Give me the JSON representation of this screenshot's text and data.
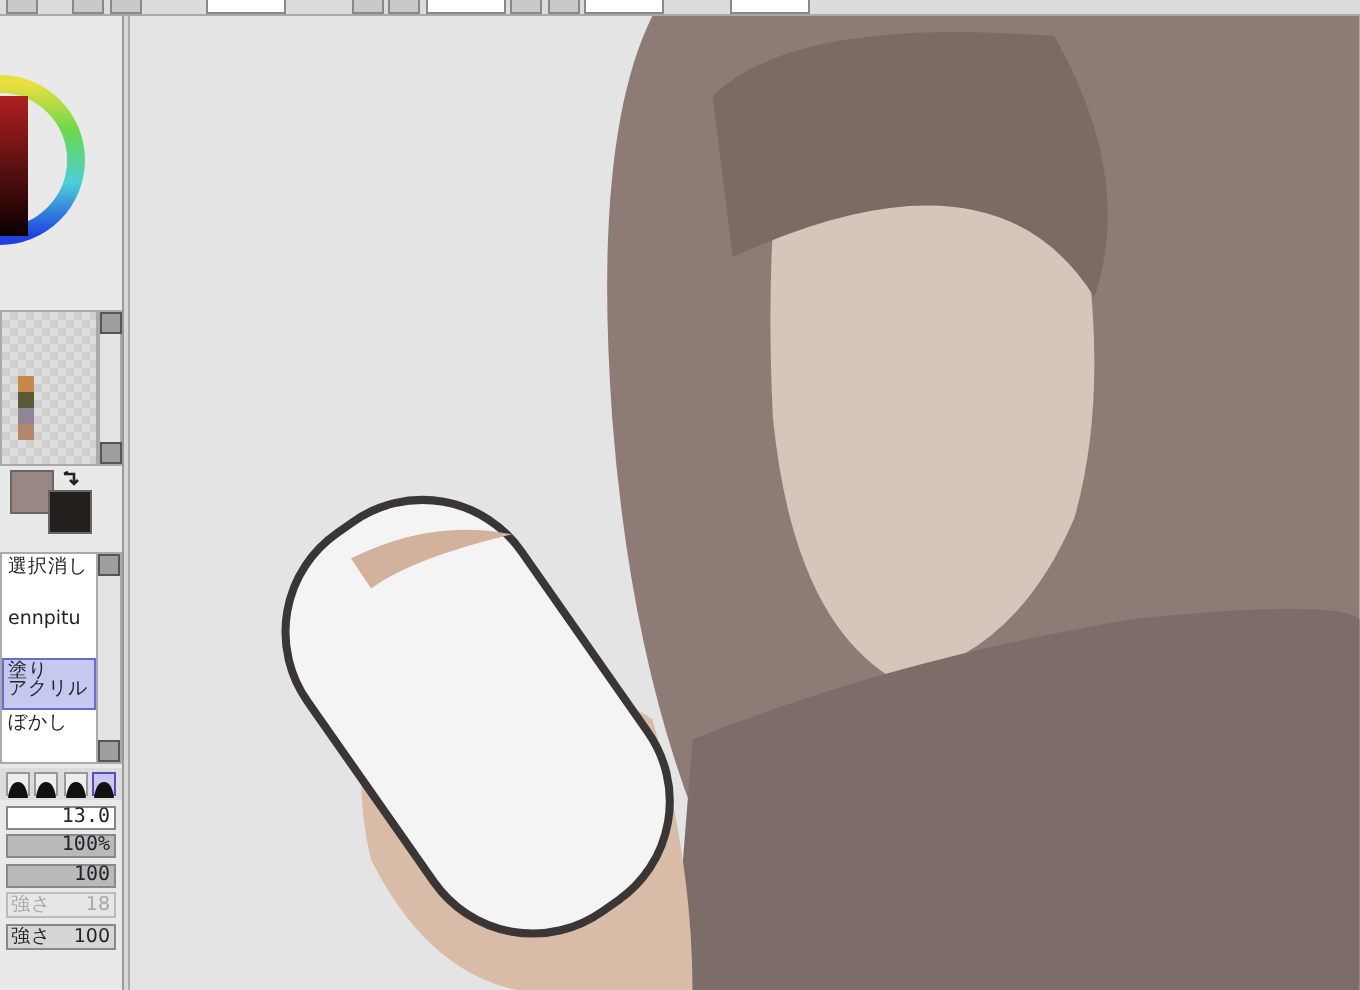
{
  "swatches": [
    {
      "color": "#c8874f"
    },
    {
      "color": "#5b5a36"
    },
    {
      "color": "#8e8692"
    },
    {
      "color": "#b3876a"
    }
  ],
  "color_slots": [
    {
      "color": "#9a8682"
    },
    {
      "color": "#231f1d"
    }
  ],
  "tools": [
    {
      "lines": [
        "選択消し"
      ],
      "selected": false
    },
    {
      "lines": [
        "ennpitu"
      ],
      "selected": false
    },
    {
      "lines": [
        "塗り",
        "アクリル"
      ],
      "selected": true
    },
    {
      "lines": [
        "ぼかし"
      ],
      "selected": false
    }
  ],
  "brush_shapes": [
    {
      "selected": false
    },
    {
      "selected": false
    },
    {
      "selected": false
    },
    {
      "selected": true
    }
  ],
  "brush_size": {
    "value": "13.0"
  },
  "sliders": [
    {
      "reading": "100%",
      "level": 1
    },
    {
      "reading": "100",
      "level": 1
    }
  ],
  "strength": [
    {
      "label": "強さ",
      "reading": "18",
      "disabled": true
    },
    {
      "label": "強さ",
      "reading": "100",
      "disabled": false
    }
  ]
}
